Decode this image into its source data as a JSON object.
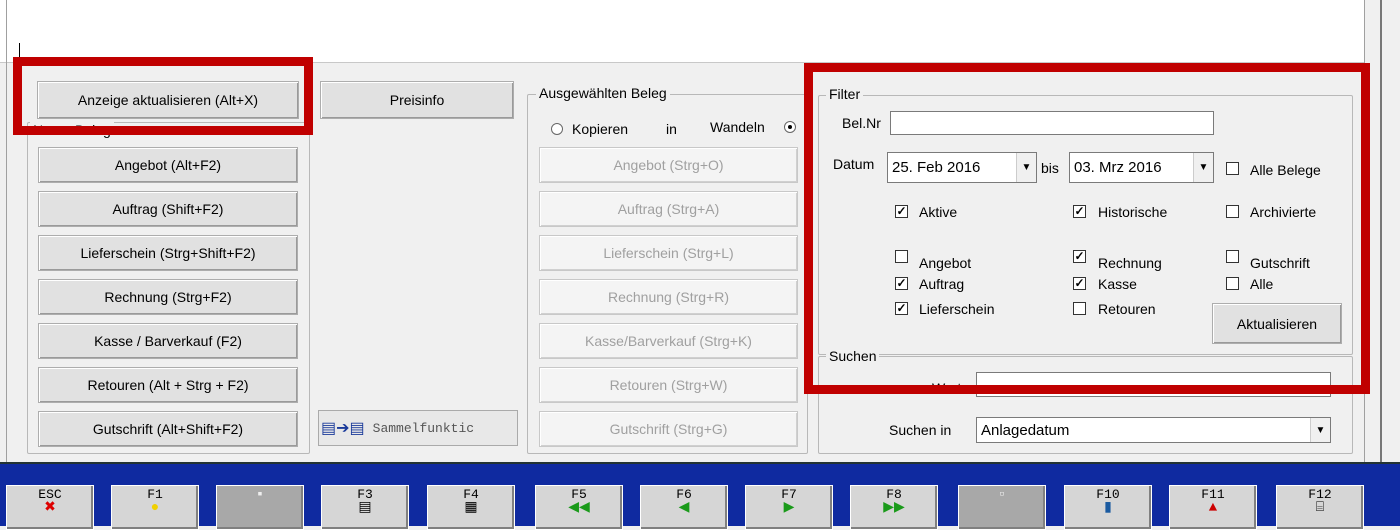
{
  "left_panel": {
    "refresh_label": "Anzeige aktualisieren (Alt+X)",
    "preisinfo_label": "Preisinfo",
    "group_title": "Neuer Beleg",
    "buttons": [
      "Angebot (Alt+F2)",
      "Auftrag (Shift+F2)",
      "Lieferschein (Strg+Shift+F2)",
      "Rechnung (Strg+F2)",
      "Kasse / Barverkauf (F2)",
      "Retouren (Alt + Strg + F2)",
      "Gutschrift (Alt+Shift+F2)"
    ],
    "sammel_label": "Sammelfunktic"
  },
  "middle_panel": {
    "title": "Ausgewählten Beleg",
    "kopieren_label": "Kopieren",
    "in_label": "in",
    "wandeln_label": "Wandeln",
    "buttons": [
      "Angebot (Strg+O)",
      "Auftrag (Strg+A)",
      "Lieferschein (Strg+L)",
      "Rechnung (Strg+R)",
      "Kasse/Barverkauf (Strg+K)",
      "Retouren (Strg+W)",
      "Gutschrift (Strg+G)"
    ]
  },
  "filter": {
    "title": "Filter",
    "belnr_label": "Bel.Nr",
    "belnr_value": "",
    "datum_label": "Datum",
    "date_from": "25. Feb 2016",
    "bis_label": "bis",
    "date_to": "03. Mrz 2016",
    "alle_belege": "Alle Belege",
    "aktive": "Aktive",
    "historische": "Historische",
    "archivierte": "Archivierte",
    "angebot": "Angebot",
    "rechnung": "Rechnung",
    "gutschrift": "Gutschrift",
    "auftrag": "Auftrag",
    "kasse": "Kasse",
    "alle": "Alle",
    "lieferschein": "Lieferschein",
    "retouren": "Retouren",
    "aktualisieren_label": "Aktualisieren"
  },
  "suchen": {
    "title": "Suchen",
    "wert_label": "Wert",
    "wert_value": "",
    "suchen_in_label": "Suchen in",
    "suchen_in_value": "Anlagedatum"
  },
  "toolbar": {
    "keys": [
      "ESC",
      "F1",
      "",
      "F3",
      "F4",
      "F5",
      "F6",
      "F7",
      "F8",
      "",
      "F10",
      "F11",
      "F12"
    ]
  },
  "colors": {
    "highlight": "#c00000",
    "toolbar_bg": "#0f2aa0"
  }
}
